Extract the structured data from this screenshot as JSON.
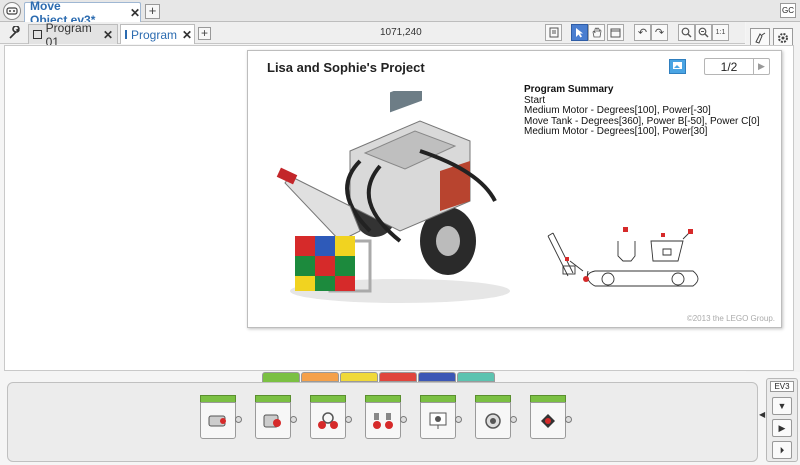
{
  "titlebar": {
    "file_tab": "Move Object.ev3*",
    "file_close": "✕",
    "add_file": "+",
    "gc_badge": "GC"
  },
  "progbar": {
    "tabs": [
      {
        "label": "Program 01",
        "active": false
      },
      {
        "label": "Program",
        "active": true
      }
    ],
    "close_glyph": "✕",
    "add_program": "+",
    "coordinates": "1071,240"
  },
  "content": {
    "title": "Lisa and Sophie's Project",
    "page_indicator": "1/2",
    "summary_heading": "Program Summary",
    "summary_lines": [
      "Start",
      "Medium Motor - Degrees[100], Power[-30]",
      "Move Tank - Degrees[360], Power B[-50], Power C[0]",
      "Medium Motor - Degrees[100], Power[30]"
    ],
    "copyright": "©2013 the LEGO Group."
  },
  "palette": {
    "tab_colors": [
      "#7bc043",
      "#f5a14a",
      "#f0d93a",
      "#e0463d",
      "#3c57b5",
      "#5cc3b0"
    ],
    "blocks": [
      {
        "name": "medium-motor-block"
      },
      {
        "name": "large-motor-block"
      },
      {
        "name": "move-steering-block"
      },
      {
        "name": "move-tank-block"
      },
      {
        "name": "display-block"
      },
      {
        "name": "sound-block"
      },
      {
        "name": "brick-status-light-block"
      }
    ]
  },
  "hardware": {
    "label": "EV3"
  }
}
